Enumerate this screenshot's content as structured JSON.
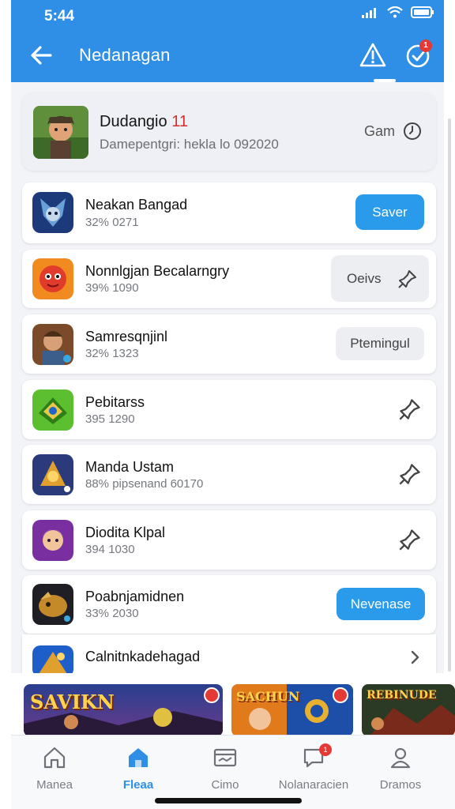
{
  "status_bar": {
    "time": "5:44"
  },
  "header": {
    "title": "Nedanagan",
    "notification_count": "1",
    "accent": "#2f8fe6"
  },
  "hero": {
    "title": "Dudangio",
    "title_number": "11",
    "subtitle": "Damepentgri: hekla lo 092020",
    "right_label": "Gam"
  },
  "items": [
    {
      "title": "Neakan Bangad",
      "subtitle": "32% 0271",
      "action": "Saver",
      "action_style": "primary"
    },
    {
      "title": "Nonnlgjan Becalarngry",
      "subtitle": "39% 1090",
      "action": "Oeivs",
      "action_style": "grey-pin"
    },
    {
      "title": "Samresqnjinl",
      "subtitle": "32% 1323",
      "action": "Ptemingul",
      "action_style": "grey"
    },
    {
      "title": "Pebitarss",
      "subtitle": "395 1290",
      "action": "",
      "action_style": "pin"
    },
    {
      "title": "Manda Ustam",
      "subtitle": "88% pipsenand 60170",
      "action": "",
      "action_style": "pin"
    },
    {
      "title": "Diodita Klpal",
      "subtitle": "394 1030",
      "action": "",
      "action_style": "pin"
    },
    {
      "title": "Poabnjamidnen",
      "subtitle": "33% 2030",
      "action": "Nevenase",
      "action_style": "primary"
    },
    {
      "title": "Calnitnkadehagad",
      "subtitle": "",
      "action": "",
      "action_style": "chevron"
    }
  ],
  "banners": [
    {
      "text": "SAVIKN"
    },
    {
      "text": "SACHUN"
    },
    {
      "text": "REBINUDE"
    }
  ],
  "bottom_nav": [
    {
      "label": "Manea",
      "icon": "home-icon"
    },
    {
      "label": "Fleaa",
      "icon": "building-icon",
      "active": true
    },
    {
      "label": "Cimo",
      "icon": "card-icon"
    },
    {
      "label": "Nolanaracien",
      "icon": "chat-icon",
      "badge": "1"
    },
    {
      "label": "Dramos",
      "icon": "person-icon"
    }
  ]
}
